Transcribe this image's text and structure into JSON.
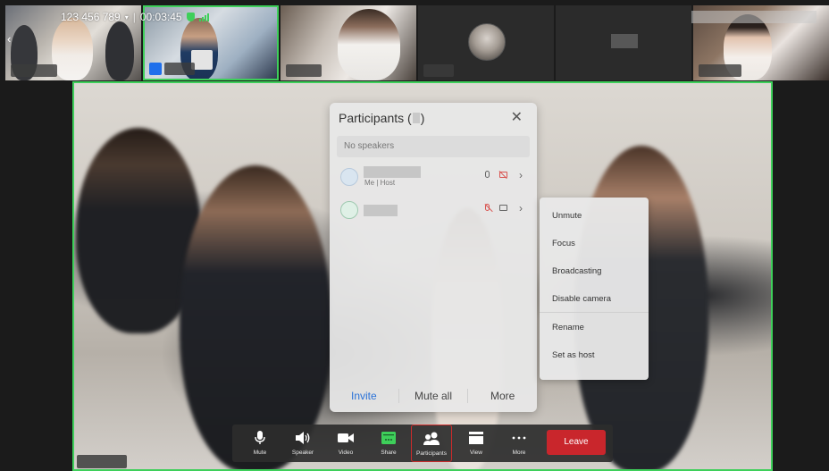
{
  "meeting": {
    "id": "123 456 789",
    "id_caret": "▾",
    "separator": "|",
    "duration": "00:03:45",
    "security_icon": "shield-icon",
    "network_icon": "signal-icon",
    "accent_color": "#3ecf5a"
  },
  "back_icon": "chevron-left-icon",
  "participants_panel": {
    "title": "Participants (",
    "title_close": ")",
    "close_icon": "close-icon",
    "speakers_text": "No speakers",
    "rows": [
      {
        "role": "Me | Host",
        "audio": "unmuted",
        "video": "off"
      },
      {
        "role": "",
        "audio": "muted",
        "video": "on"
      }
    ],
    "footer": {
      "invite": "Invite",
      "mute_all": "Mute all",
      "more": "More"
    }
  },
  "context_menu": {
    "items": [
      "Unmute",
      "Focus",
      "Broadcasting",
      "Disable camera",
      "Rename",
      "Set as host"
    ]
  },
  "toolbar": {
    "mute": "Mute",
    "speaker": "Speaker",
    "video": "Video",
    "share": "Share",
    "participants": "Participants",
    "view": "View",
    "more": "More",
    "leave": "Leave",
    "leave_color": "#c9262c"
  }
}
